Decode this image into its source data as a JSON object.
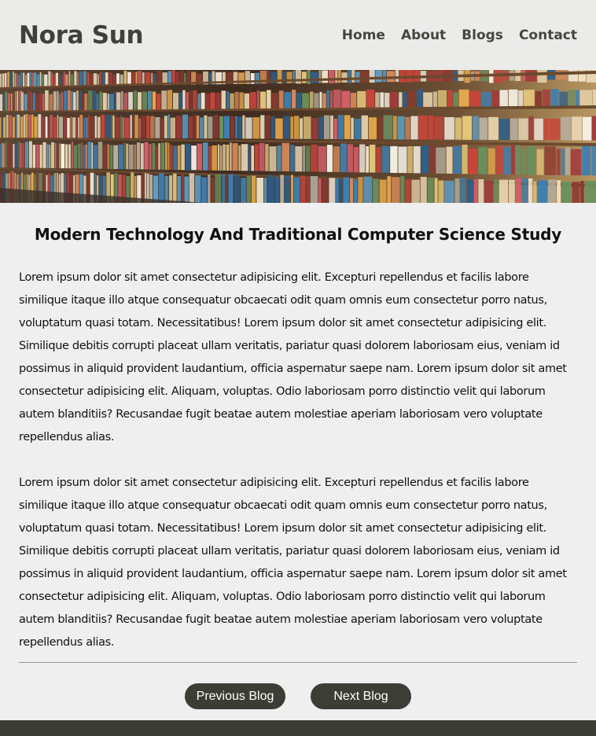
{
  "header": {
    "brand": "Nora Sun",
    "nav": [
      "Home",
      "About",
      "Blogs",
      "Contact"
    ]
  },
  "hero": {
    "icon": "bookshelf-image"
  },
  "article": {
    "title": "Modern Technology And Traditional Computer Science Study",
    "paragraphs": [
      "Lorem ipsum dolor sit amet consectetur adipisicing elit. Excepturi repellendus et facilis labore similique itaque illo atque consequatur obcaecati odit quam omnis eum consectetur porro natus, voluptatum quasi totam. Necessitatibus! Lorem ipsum dolor sit amet consectetur adipisicing elit. Similique debitis corrupti placeat ullam veritatis, pariatur quasi dolorem laboriosam eius, veniam id possimus in aliquid provident laudantium, officia aspernatur saepe nam. Lorem ipsum dolor sit amet consectetur adipisicing elit. Aliquam, voluptas. Odio laboriosam porro distinctio velit qui laborum autem blanditiis? Recusandae fugit beatae autem molestiae aperiam laboriosam vero voluptate repellendus alias.",
      "Lorem ipsum dolor sit amet consectetur adipisicing elit. Excepturi repellendus et facilis labore similique itaque illo atque consequatur obcaecati odit quam omnis eum consectetur porro natus, voluptatum quasi totam. Necessitatibus! Lorem ipsum dolor sit amet consectetur adipisicing elit. Similique debitis corrupti placeat ullam veritatis, pariatur quasi dolorem laboriosam eius, veniam id possimus in aliquid provident laudantium, officia aspernatur saepe nam. Lorem ipsum dolor sit amet consectetur adipisicing elit. Aliquam, voluptas. Odio laboriosam porro distinctio velit qui laborum autem blanditiis? Recusandae fugit beatae autem molestiae aperiam laboriosam vero voluptate repellendus alias."
    ]
  },
  "pager": {
    "previous_label": "Previous Blog",
    "next_label": "Next Blog"
  },
  "colors": {
    "header_bg": "#ebecea",
    "brand_text": "#3f4138",
    "button_bg": "#3c3e36",
    "footer_bg": "#3a3c35",
    "page_bg": "#efefef"
  }
}
